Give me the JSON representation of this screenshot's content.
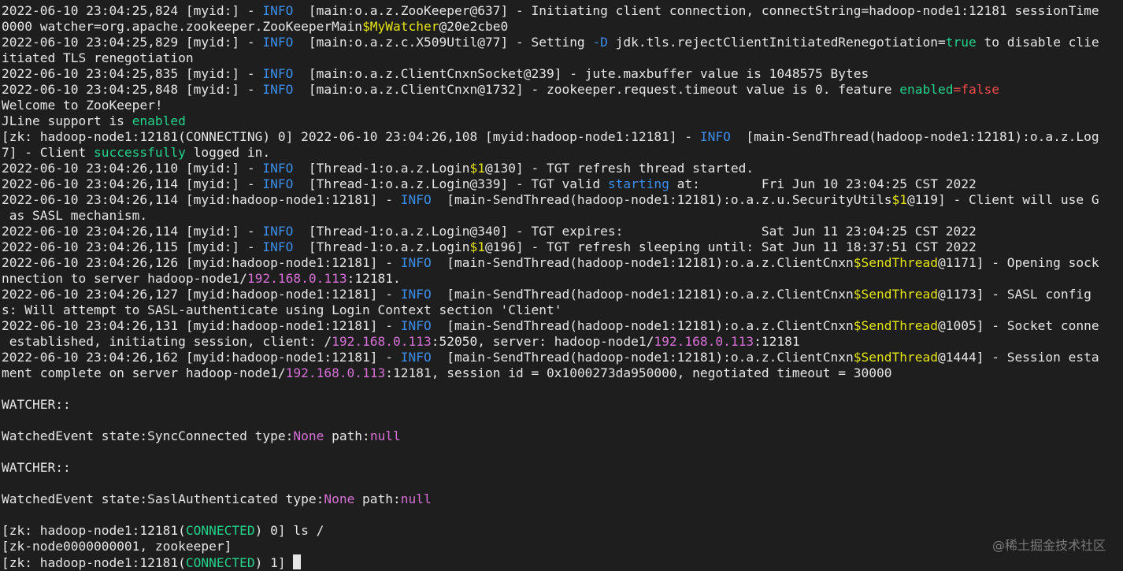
{
  "colors": {
    "background": "#1e1e1e",
    "default": "#e6e6e6",
    "info": "#3b8eea",
    "yellow": "#e5e510",
    "green": "#23d18b",
    "red": "#f14c4c",
    "magenta": "#d670d6",
    "watermark": "#7a7a7a"
  },
  "terminal": {
    "lines": [
      [
        [
          "2022-06-10 23:04:25,824 [myid:] - "
        ],
        [
          "INFO",
          "info"
        ],
        [
          "  [main:o.a.z.ZooKeeper@637] - Initiating client connection, connectString=hadoop-node1:12181 sessionTime"
        ]
      ],
      [
        [
          "0000 watcher=org.apache.zookeeper.ZooKeeperMain"
        ],
        [
          "$MyWatcher",
          "yellow"
        ],
        [
          "@20e2cbe0"
        ]
      ],
      [
        [
          "2022-06-10 23:04:25,829 [myid:] - "
        ],
        [
          "INFO",
          "info"
        ],
        [
          "  [main:o.a.z.c.X509Util@77] - Setting "
        ],
        [
          "-D",
          "info"
        ],
        [
          " jdk.tls.rejectClientInitiatedRenegotiation="
        ],
        [
          "true",
          "green"
        ],
        [
          " to disable clie"
        ]
      ],
      [
        [
          "itiated TLS renegotiation"
        ]
      ],
      [
        [
          "2022-06-10 23:04:25,835 [myid:] - "
        ],
        [
          "INFO",
          "info"
        ],
        [
          "  [main:o.a.z.ClientCnxnSocket@239] - jute.maxbuffer value is 1048575 Bytes"
        ]
      ],
      [
        [
          "2022-06-10 23:04:25,848 [myid:] - "
        ],
        [
          "INFO",
          "info"
        ],
        [
          "  [main:o.a.z.ClientCnxn@1732] - zookeeper.request.timeout value is 0. feature "
        ],
        [
          "enabled",
          "green"
        ],
        [
          "=",
          "red"
        ],
        [
          "false",
          "red"
        ]
      ],
      [
        [
          "Welcome to ZooKeeper!"
        ]
      ],
      [
        [
          "JLine support is "
        ],
        [
          "enabled",
          "green"
        ]
      ],
      [
        [
          "[zk: hadoop-node1:12181(CONNECTING) 0] 2022-06-10 23:04:26,108 [myid:hadoop-node1:12181] - "
        ],
        [
          "INFO",
          "info"
        ],
        [
          "  [main-SendThread(hadoop-node1:12181):o.a.z.Log"
        ]
      ],
      [
        [
          "7] - Client "
        ],
        [
          "successfully",
          "green"
        ],
        [
          " logged in."
        ]
      ],
      [
        [
          "2022-06-10 23:04:26,110 [myid:] - "
        ],
        [
          "INFO",
          "info"
        ],
        [
          "  [Thread-1:o.a.z.Login"
        ],
        [
          "$1",
          "yellow"
        ],
        [
          "@130] - TGT refresh thread started."
        ]
      ],
      [
        [
          "2022-06-10 23:04:26,114 [myid:] - "
        ],
        [
          "INFO",
          "info"
        ],
        [
          "  [Thread-1:o.a.z.Login@339] - TGT valid "
        ],
        [
          "starting",
          "info"
        ],
        [
          " at:        Fri Jun 10 23:04:25 CST 2022"
        ]
      ],
      [
        [
          "2022-06-10 23:04:26,114 [myid:hadoop-node1:12181] - "
        ],
        [
          "INFO",
          "info"
        ],
        [
          "  [main-SendThread(hadoop-node1:12181):o.a.z.u.SecurityUtils"
        ],
        [
          "$1",
          "yellow"
        ],
        [
          "@119] - Client will use G"
        ]
      ],
      [
        [
          " as SASL mechanism."
        ]
      ],
      [
        [
          "2022-06-10 23:04:26,114 [myid:] - "
        ],
        [
          "INFO",
          "info"
        ],
        [
          "  [Thread-1:o.a.z.Login@340] - TGT expires:                  Sat Jun 11 23:04:25 CST 2022"
        ]
      ],
      [
        [
          "2022-06-10 23:04:26,115 [myid:] - "
        ],
        [
          "INFO",
          "info"
        ],
        [
          "  [Thread-1:o.a.z.Login"
        ],
        [
          "$1",
          "yellow"
        ],
        [
          "@196] - TGT refresh sleeping until: Sat Jun 11 18:37:51 CST 2022"
        ]
      ],
      [
        [
          "2022-06-10 23:04:26,126 [myid:hadoop-node1:12181] - "
        ],
        [
          "INFO",
          "info"
        ],
        [
          "  [main-SendThread(hadoop-node1:12181):o.a.z.ClientCnxn"
        ],
        [
          "$SendThread",
          "yellow"
        ],
        [
          "@1171] - Opening sock"
        ]
      ],
      [
        [
          "nnection to server hadoop-node1/"
        ],
        [
          "192.168.0.113",
          "magenta"
        ],
        [
          ":12181."
        ]
      ],
      [
        [
          "2022-06-10 23:04:26,127 [myid:hadoop-node1:12181] - "
        ],
        [
          "INFO",
          "info"
        ],
        [
          "  [main-SendThread(hadoop-node1:12181):o.a.z.ClientCnxn"
        ],
        [
          "$SendThread",
          "yellow"
        ],
        [
          "@1173] - SASL config"
        ]
      ],
      [
        [
          "s: Will attempt to SASL-authenticate using Login Context section 'Client'"
        ]
      ],
      [
        [
          "2022-06-10 23:04:26,131 [myid:hadoop-node1:12181] - "
        ],
        [
          "INFO",
          "info"
        ],
        [
          "  [main-SendThread(hadoop-node1:12181):o.a.z.ClientCnxn"
        ],
        [
          "$SendThread",
          "yellow"
        ],
        [
          "@1005] - Socket conne"
        ]
      ],
      [
        [
          " established, initiating session, client: /"
        ],
        [
          "192.168.0.113",
          "magenta"
        ],
        [
          ":52050, server: hadoop-node1/"
        ],
        [
          "192.168.0.113",
          "magenta"
        ],
        [
          ":12181"
        ]
      ],
      [
        [
          "2022-06-10 23:04:26,162 [myid:hadoop-node1:12181] - "
        ],
        [
          "INFO",
          "info"
        ],
        [
          "  [main-SendThread(hadoop-node1:12181):o.a.z.ClientCnxn"
        ],
        [
          "$SendThread",
          "yellow"
        ],
        [
          "@1444] - Session esta"
        ]
      ],
      [
        [
          "ment complete on server hadoop-node1/"
        ],
        [
          "192.168.0.113",
          "magenta"
        ],
        [
          ":12181, session id = 0x1000273da950000, negotiated timeout = 30000"
        ]
      ],
      [],
      [
        [
          "WATCHER::"
        ]
      ],
      [],
      [
        [
          "WatchedEvent state:SyncConnected type:"
        ],
        [
          "None",
          "magenta"
        ],
        [
          " path:"
        ],
        [
          "null",
          "magenta"
        ]
      ],
      [],
      [
        [
          "WATCHER::"
        ]
      ],
      [],
      [
        [
          "WatchedEvent state:SaslAuthenticated type:"
        ],
        [
          "None",
          "magenta"
        ],
        [
          " path:"
        ],
        [
          "null",
          "magenta"
        ]
      ],
      [],
      [
        [
          "[zk: hadoop-node1:12181("
        ],
        [
          "CONNECTED",
          "green"
        ],
        [
          ") 0] ls /"
        ]
      ],
      [
        [
          "[zk-node0000000001, zookeeper]"
        ]
      ],
      [
        [
          "[zk: hadoop-node1:12181("
        ],
        [
          "CONNECTED",
          "green"
        ],
        [
          ") 1] "
        ]
      ]
    ],
    "cursor_line": 35
  },
  "watermark": "@稀土掘金技术社区"
}
